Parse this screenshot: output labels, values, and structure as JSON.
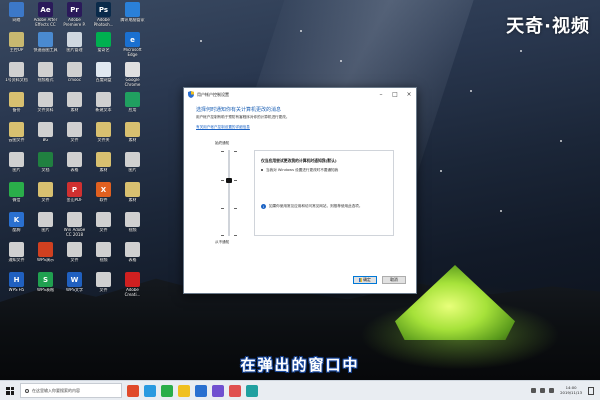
{
  "watermark": "天奇·视频",
  "subtitle": "在弹出的窗口中",
  "colors": {
    "accent": "#1b5fb4",
    "link": "#1a62c4",
    "taskbar": "#e9edf2"
  },
  "desktop_icons": [
    {
      "label": "网络",
      "color": "#3c78c8",
      "glyph": ""
    },
    {
      "label": "Adobe After Effects CC",
      "color": "#2a1a5a",
      "glyph": "Ae"
    },
    {
      "label": "Adobe Premiere P.",
      "color": "#2a1a5a",
      "glyph": "Pr"
    },
    {
      "label": "Adobe Photosh...",
      "color": "#0a2a4a",
      "glyph": "Ps"
    },
    {
      "label": "腾讯电脑管家",
      "color": "#2a80d8",
      "glyph": ""
    },
    {
      "label": "主控OP",
      "color": "#c8b870",
      "glyph": ""
    },
    {
      "label": "快速画图工具",
      "color": "#4a8ad0",
      "glyph": ""
    },
    {
      "label": "图片管理",
      "color": "#d0d8e0",
      "glyph": ""
    },
    {
      "label": "爱奇艺",
      "color": "#00b050",
      "glyph": ""
    },
    {
      "label": "Microsoft Edge",
      "color": "#1a70d0",
      "glyph": "e"
    },
    {
      "label": "1号资料文档",
      "color": "#d0d0d0",
      "glyph": ""
    },
    {
      "label": "视频格式",
      "color": "#d0d0d0",
      "glyph": ""
    },
    {
      "label": "cmooc",
      "color": "#d0d0d0",
      "glyph": ""
    },
    {
      "label": "百度网盘",
      "color": "#e0e8f0",
      "glyph": ""
    },
    {
      "label": "Google Chrome",
      "color": "#e0e0e0",
      "glyph": ""
    },
    {
      "label": "备份",
      "color": "#d8c070",
      "glyph": ""
    },
    {
      "label": "文件资料",
      "color": "#d0d0d0",
      "glyph": ""
    },
    {
      "label": "素材",
      "color": "#d0d0d0",
      "glyph": ""
    },
    {
      "label": "新建文本",
      "color": "#d0d0d0",
      "glyph": ""
    },
    {
      "label": "应用",
      "color": "#20a060",
      "glyph": ""
    },
    {
      "label": "云图文件",
      "color": "#d8c070",
      "glyph": ""
    },
    {
      "label": "BG",
      "color": "#d0d0d0",
      "glyph": ""
    },
    {
      "label": "文件",
      "color": "#d0d0d0",
      "glyph": ""
    },
    {
      "label": "文件夹",
      "color": "#d8c070",
      "glyph": ""
    },
    {
      "label": "素材",
      "color": "#d8c070",
      "glyph": ""
    },
    {
      "label": "图片",
      "color": "#d0d0d0",
      "glyph": ""
    },
    {
      "label": "文档",
      "color": "#208040",
      "glyph": ""
    },
    {
      "label": "表格",
      "color": "#d0d0d0",
      "glyph": ""
    },
    {
      "label": "素材",
      "color": "#d8c070",
      "glyph": ""
    },
    {
      "label": "图片",
      "color": "#d0d0d0",
      "glyph": ""
    },
    {
      "label": "微信",
      "color": "#2aae4a",
      "glyph": ""
    },
    {
      "label": "文件",
      "color": "#d8c070",
      "glyph": ""
    },
    {
      "label": "金山PDF",
      "color": "#d03030",
      "glyph": "P"
    },
    {
      "label": "软件",
      "color": "#e06020",
      "glyph": "X"
    },
    {
      "label": "素材",
      "color": "#d8c070",
      "glyph": ""
    },
    {
      "label": "酷狗",
      "color": "#2a70d0",
      "glyph": "K"
    },
    {
      "label": "图片",
      "color": "#d0d0d0",
      "glyph": ""
    },
    {
      "label": "Win Adobe CC 2018",
      "color": "#d0d0d0",
      "glyph": ""
    },
    {
      "label": "文件",
      "color": "#d0d0d0",
      "glyph": ""
    },
    {
      "label": "视频",
      "color": "#d0d0d0",
      "glyph": ""
    },
    {
      "label": "通知文件",
      "color": "#d0d0d0",
      "glyph": ""
    },
    {
      "label": "WPS演示",
      "color": "#d04020",
      "glyph": ""
    },
    {
      "label": "文件",
      "color": "#d0d0d0",
      "glyph": ""
    },
    {
      "label": "视频",
      "color": "#d0d0d0",
      "glyph": ""
    },
    {
      "label": "表格",
      "color": "#d0d0d0",
      "glyph": ""
    },
    {
      "label": "WPS H5",
      "color": "#2060c0",
      "glyph": "H"
    },
    {
      "label": "WPS表格",
      "color": "#20a050",
      "glyph": "S"
    },
    {
      "label": "WPS文字",
      "color": "#2060c0",
      "glyph": "W"
    },
    {
      "label": "文件",
      "color": "#d0d0d0",
      "glyph": ""
    },
    {
      "label": "Adobe Creati...",
      "color": "#d02020",
      "glyph": ""
    }
  ],
  "dialog": {
    "title": "用户帐户控制设置",
    "heading": "选择何时通知你有关计算机更改的消息",
    "description": "用户帐户控制有助于预防有害程序对你的计算机进行更改。",
    "link": "有关用户帐户控制设置的详细信息",
    "level_top": "始终通知",
    "level_bottom": "从不通知",
    "slider_level": "3/4",
    "panel_title": "仅当应用尝试更改我的计算机时通知我(默认)",
    "panel_item": "当我对 Windows 设置进行更改时不要通知我",
    "panel_note": "如果你使用常见应用和访问常见网站，则推荐使用此选项。",
    "ok_label": "确定",
    "cancel_label": "取消"
  },
  "taskbar": {
    "search_placeholder": "在这里输入你要搜索的内容",
    "time": "14:00",
    "date": "2019/11/13",
    "app_colors": [
      "#e04a2a",
      "#2a9ae0",
      "#2aae4a",
      "#f0c020",
      "#2a70d0",
      "#7050d0",
      "#e05050",
      "#20a0a0"
    ]
  }
}
